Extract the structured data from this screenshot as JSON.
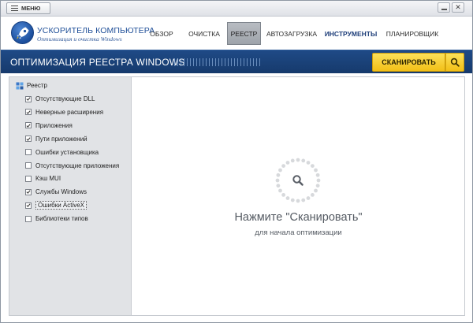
{
  "titlebar": {
    "menu_label": "МЕНЮ",
    "icons": {
      "menu": "hamburger-icon",
      "minimize": "minimize-icon",
      "close": "close-icon"
    },
    "close_glyph": "✕"
  },
  "header": {
    "logo_title": "УСКОРИТЕЛЬ КОМПЬЮТЕРА",
    "logo_subtitle": "Оптимизация и очистка Windows",
    "logo_icon": "rocket-logo-icon",
    "nav": [
      {
        "id": "overview",
        "label": "ОБЗОР",
        "active": false,
        "bold": false
      },
      {
        "id": "cleanup",
        "label": "ОЧИСТКА",
        "active": false,
        "bold": false
      },
      {
        "id": "registry",
        "label": "РЕЕСТР",
        "active": true,
        "bold": false
      },
      {
        "id": "autostart",
        "label": "АВТОЗАГРУЗКА",
        "active": false,
        "bold": false
      },
      {
        "id": "tools",
        "label": "ИНСТРУМЕНТЫ",
        "active": false,
        "bold": true
      },
      {
        "id": "scheduler",
        "label": "ПЛАНИРОВЩИК",
        "active": false,
        "bold": false
      }
    ]
  },
  "banner": {
    "title": "ОПТИМИЗАЦИЯ РЕЕСТРА WINDOWS",
    "scan_label": "СКАНИРОВАТЬ",
    "scan_icon": "search-icon"
  },
  "sidebar": {
    "root_label": "Реестр",
    "root_icon": "registry-icon",
    "items": [
      {
        "label": "Отсутствующие DLL",
        "checked": true,
        "selected": false
      },
      {
        "label": "Неверные расширения",
        "checked": true,
        "selected": false
      },
      {
        "label": "Приложения",
        "checked": true,
        "selected": false
      },
      {
        "label": "Пути приложений",
        "checked": true,
        "selected": false
      },
      {
        "label": "Ошибки установщика",
        "checked": false,
        "selected": false
      },
      {
        "label": "Отсутствующие приложения",
        "checked": false,
        "selected": false
      },
      {
        "label": "Кэш MUI",
        "checked": false,
        "selected": false
      },
      {
        "label": "Службы Windows",
        "checked": true,
        "selected": false
      },
      {
        "label": "Ошибки ActiveX",
        "checked": true,
        "selected": true
      },
      {
        "label": "Библиотеки типов",
        "checked": false,
        "selected": false
      }
    ]
  },
  "content": {
    "spinner_icon": "search-icon",
    "hint_main": "Нажмите \"Сканировать\"",
    "hint_sub": "для начала оптимизации"
  },
  "colors": {
    "banner": "#1f4a86",
    "scan_button": "#f5c623",
    "brand_text": "#1f4f98",
    "sidebar_bg": "#e1e3e6"
  }
}
